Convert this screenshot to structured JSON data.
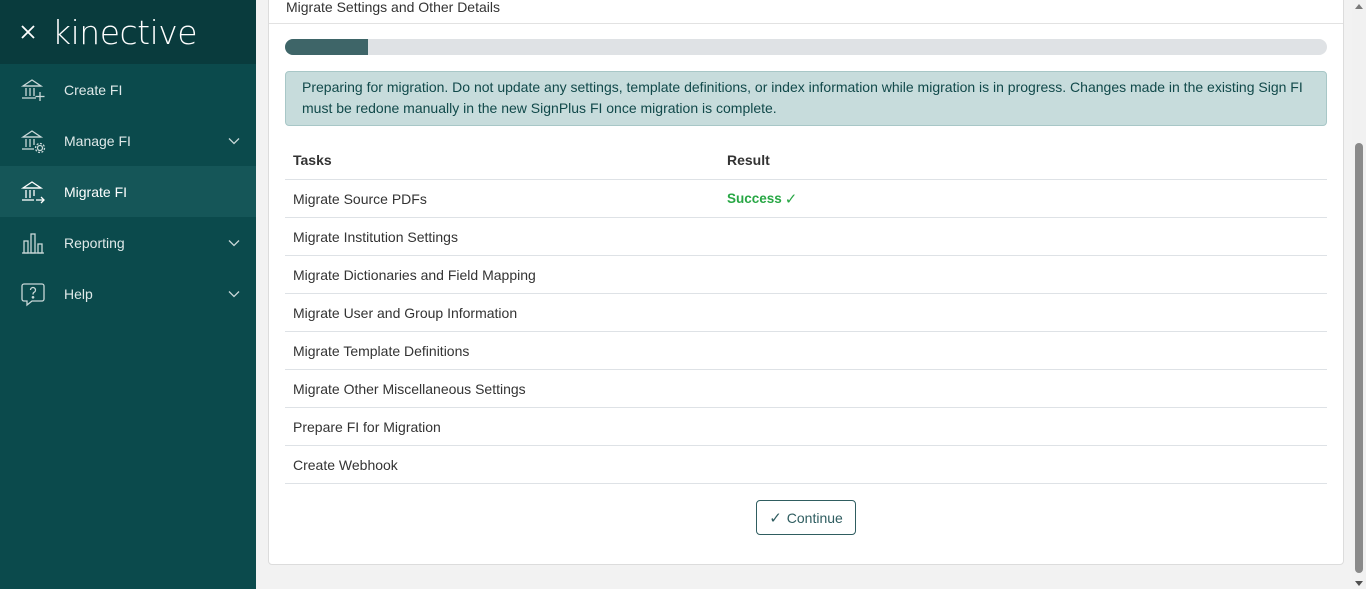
{
  "brand": {
    "logo_text": "kinective",
    "close_icon": "close-icon"
  },
  "sidebar": {
    "items": [
      {
        "label": "Create FI",
        "icon": "bank-plus-icon",
        "has_chevron": false,
        "active": false
      },
      {
        "label": "Manage FI",
        "icon": "bank-gear-icon",
        "has_chevron": true,
        "active": false
      },
      {
        "label": "Migrate FI",
        "icon": "bank-arrow-icon",
        "has_chevron": false,
        "active": true
      },
      {
        "label": "Reporting",
        "icon": "bar-chart-icon",
        "has_chevron": true,
        "active": false
      },
      {
        "label": "Help",
        "icon": "help-bubble-icon",
        "has_chevron": true,
        "active": false
      }
    ]
  },
  "main": {
    "card_title": "Migrate Settings and Other Details",
    "progress_fraction": 0.08,
    "alert_text": "Preparing for migration. Do not update any settings, template definitions, or index information while migration is in progress. Changes made in the existing Sign FI must be redone manually in the new SignPlus FI once migration is complete.",
    "table": {
      "headers": [
        "Tasks",
        "Result"
      ],
      "rows": [
        {
          "task": "Migrate Source PDFs",
          "result": "Success",
          "result_icon": "check-icon"
        },
        {
          "task": "Migrate Institution Settings",
          "result": ""
        },
        {
          "task": "Migrate Dictionaries and Field Mapping",
          "result": ""
        },
        {
          "task": "Migrate User and Group Information",
          "result": ""
        },
        {
          "task": "Migrate Template Definitions",
          "result": ""
        },
        {
          "task": "Migrate Other Miscellaneous Settings",
          "result": ""
        },
        {
          "task": "Prepare FI for Migration",
          "result": ""
        },
        {
          "task": "Create Webhook",
          "result": ""
        }
      ]
    },
    "continue_button": {
      "label": "Continue",
      "icon": "check-icon"
    }
  },
  "colors": {
    "sidebar_bg": "#0b4a4c",
    "accent": "#2f5d60",
    "success": "#28a745",
    "alert_bg": "#c7dcdc"
  }
}
